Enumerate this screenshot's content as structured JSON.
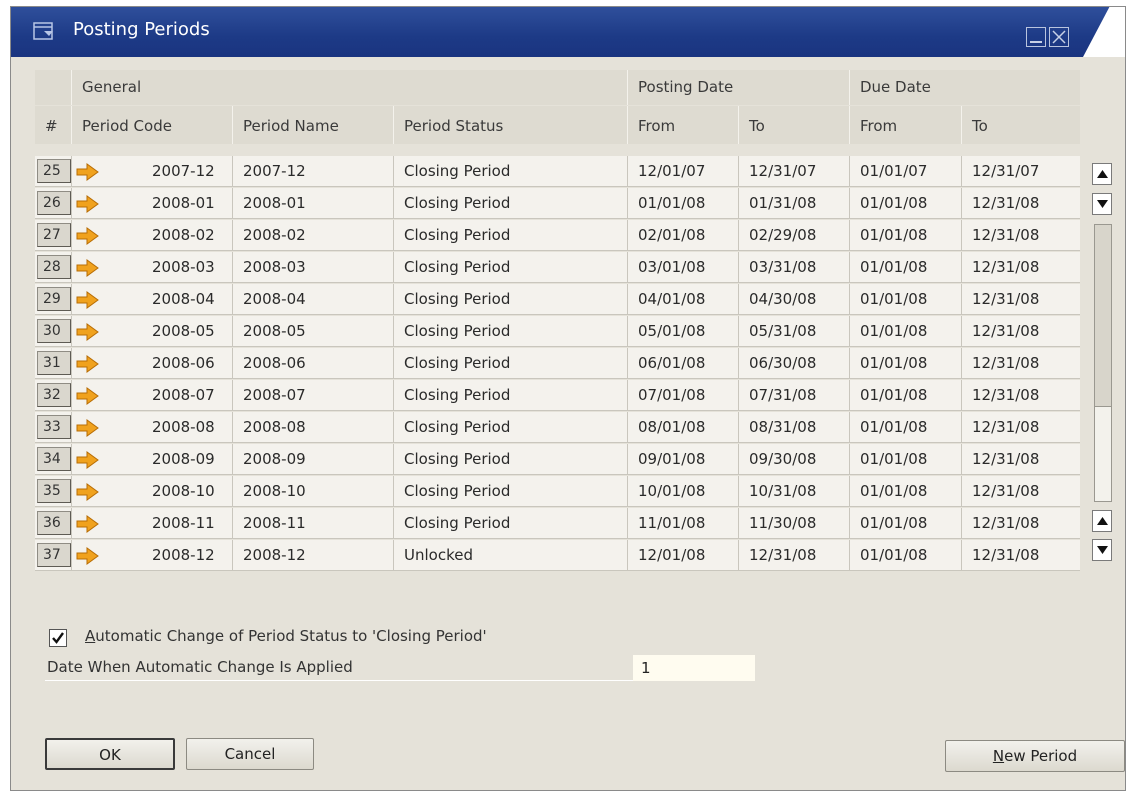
{
  "window": {
    "title": "Posting Periods"
  },
  "header": {
    "groups": {
      "general": "General",
      "posting_date": "Posting Date",
      "due_date": "Due Date"
    },
    "columns": {
      "num": "#",
      "period_code": "Period Code",
      "period_name": "Period Name",
      "period_status": "Period Status",
      "posting_from": "From",
      "posting_to": "To",
      "due_from": "From",
      "due_to": "To"
    }
  },
  "rows": [
    {
      "num": "25",
      "code": "2007-12",
      "name": "2007-12",
      "status": "Closing Period",
      "pfrom": "12/01/07",
      "pto": "12/31/07",
      "dfrom": "01/01/07",
      "dto": "12/31/07"
    },
    {
      "num": "26",
      "code": "2008-01",
      "name": "2008-01",
      "status": "Closing Period",
      "pfrom": "01/01/08",
      "pto": "01/31/08",
      "dfrom": "01/01/08",
      "dto": "12/31/08"
    },
    {
      "num": "27",
      "code": "2008-02",
      "name": "2008-02",
      "status": "Closing Period",
      "pfrom": "02/01/08",
      "pto": "02/29/08",
      "dfrom": "01/01/08",
      "dto": "12/31/08"
    },
    {
      "num": "28",
      "code": "2008-03",
      "name": "2008-03",
      "status": "Closing Period",
      "pfrom": "03/01/08",
      "pto": "03/31/08",
      "dfrom": "01/01/08",
      "dto": "12/31/08"
    },
    {
      "num": "29",
      "code": "2008-04",
      "name": "2008-04",
      "status": "Closing Period",
      "pfrom": "04/01/08",
      "pto": "04/30/08",
      "dfrom": "01/01/08",
      "dto": "12/31/08"
    },
    {
      "num": "30",
      "code": "2008-05",
      "name": "2008-05",
      "status": "Closing Period",
      "pfrom": "05/01/08",
      "pto": "05/31/08",
      "dfrom": "01/01/08",
      "dto": "12/31/08"
    },
    {
      "num": "31",
      "code": "2008-06",
      "name": "2008-06",
      "status": "Closing Period",
      "pfrom": "06/01/08",
      "pto": "06/30/08",
      "dfrom": "01/01/08",
      "dto": "12/31/08"
    },
    {
      "num": "32",
      "code": "2008-07",
      "name": "2008-07",
      "status": "Closing Period",
      "pfrom": "07/01/08",
      "pto": "07/31/08",
      "dfrom": "01/01/08",
      "dto": "12/31/08"
    },
    {
      "num": "33",
      "code": "2008-08",
      "name": "2008-08",
      "status": "Closing Period",
      "pfrom": "08/01/08",
      "pto": "08/31/08",
      "dfrom": "01/01/08",
      "dto": "12/31/08"
    },
    {
      "num": "34",
      "code": "2008-09",
      "name": "2008-09",
      "status": "Closing Period",
      "pfrom": "09/01/08",
      "pto": "09/30/08",
      "dfrom": "01/01/08",
      "dto": "12/31/08"
    },
    {
      "num": "35",
      "code": "2008-10",
      "name": "2008-10",
      "status": "Closing Period",
      "pfrom": "10/01/08",
      "pto": "10/31/08",
      "dfrom": "01/01/08",
      "dto": "12/31/08"
    },
    {
      "num": "36",
      "code": "2008-11",
      "name": "2008-11",
      "status": "Closing Period",
      "pfrom": "11/01/08",
      "pto": "11/30/08",
      "dfrom": "01/01/08",
      "dto": "12/31/08"
    },
    {
      "num": "37",
      "code": "2008-12",
      "name": "2008-12",
      "status": "Unlocked",
      "pfrom": "12/01/08",
      "pto": "12/31/08",
      "dfrom": "01/01/08",
      "dto": "12/31/08"
    }
  ],
  "options": {
    "auto_change_label_u": "A",
    "auto_change_label_rest": "utomatic Change of Period Status to 'Closing Period'",
    "auto_change_checked": true,
    "date_label": "Date When Automatic Change Is Applied",
    "date_value": "1"
  },
  "buttons": {
    "ok": "OK",
    "cancel": "Cancel",
    "new_period_u": "N",
    "new_period_rest": "ew Period"
  },
  "colors": {
    "titlebar": "#1d3a86",
    "arrow": "#f0a21e",
    "background": "#e5e2d9"
  },
  "icons": {
    "row_link": "orange-arrow-icon",
    "title": "form-icon"
  }
}
